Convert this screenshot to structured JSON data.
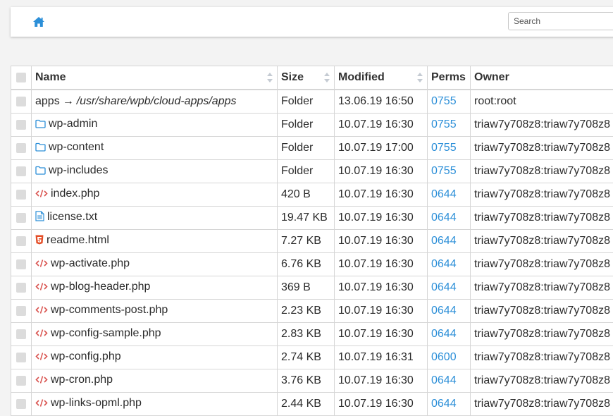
{
  "header": {
    "home_icon": "home-icon",
    "search_placeholder": "Search"
  },
  "colors": {
    "accent": "#2c8fd8",
    "code_icon": "#d9534f",
    "html_icon": "#e44d26"
  },
  "table": {
    "columns": {
      "name": "Name",
      "size": "Size",
      "modified": "Modified",
      "perms": "Perms",
      "owner": "Owner"
    },
    "rows": [
      {
        "type": "symlink",
        "name": "apps",
        "arrow": "→",
        "target": "/usr/share/wpb/cloud-apps/apps",
        "size": "Folder",
        "modified": "13.06.19 16:50",
        "perms": "0755",
        "owner": "root:root"
      },
      {
        "type": "folder",
        "icon": "folder-icon",
        "name": "wp-admin",
        "size": "Folder",
        "modified": "10.07.19 16:30",
        "perms": "0755",
        "owner": "triaw7y708z8:triaw7y708z8"
      },
      {
        "type": "folder",
        "icon": "folder-icon",
        "name": "wp-content",
        "size": "Folder",
        "modified": "10.07.19 17:00",
        "perms": "0755",
        "owner": "triaw7y708z8:triaw7y708z8"
      },
      {
        "type": "folder",
        "icon": "folder-icon",
        "name": "wp-includes",
        "size": "Folder",
        "modified": "10.07.19 16:30",
        "perms": "0755",
        "owner": "triaw7y708z8:triaw7y708z8"
      },
      {
        "type": "code",
        "icon": "code-icon",
        "name": "index.php",
        "size": "420 B",
        "modified": "10.07.19 16:30",
        "perms": "0644",
        "owner": "triaw7y708z8:triaw7y708z8"
      },
      {
        "type": "text",
        "icon": "text-file-icon",
        "name": "license.txt",
        "size": "19.47 KB",
        "modified": "10.07.19 16:30",
        "perms": "0644",
        "owner": "triaw7y708z8:triaw7y708z8"
      },
      {
        "type": "html",
        "icon": "html5-icon",
        "name": "readme.html",
        "size": "7.27 KB",
        "modified": "10.07.19 16:30",
        "perms": "0644",
        "owner": "triaw7y708z8:triaw7y708z8"
      },
      {
        "type": "code",
        "icon": "code-icon",
        "name": "wp-activate.php",
        "size": "6.76 KB",
        "modified": "10.07.19 16:30",
        "perms": "0644",
        "owner": "triaw7y708z8:triaw7y708z8"
      },
      {
        "type": "code",
        "icon": "code-icon",
        "name": "wp-blog-header.php",
        "size": "369 B",
        "modified": "10.07.19 16:30",
        "perms": "0644",
        "owner": "triaw7y708z8:triaw7y708z8"
      },
      {
        "type": "code",
        "icon": "code-icon",
        "name": "wp-comments-post.php",
        "size": "2.23 KB",
        "modified": "10.07.19 16:30",
        "perms": "0644",
        "owner": "triaw7y708z8:triaw7y708z8"
      },
      {
        "type": "code",
        "icon": "code-icon",
        "name": "wp-config-sample.php",
        "size": "2.83 KB",
        "modified": "10.07.19 16:30",
        "perms": "0644",
        "owner": "triaw7y708z8:triaw7y708z8"
      },
      {
        "type": "code",
        "icon": "code-icon",
        "name": "wp-config.php",
        "size": "2.74 KB",
        "modified": "10.07.19 16:31",
        "perms": "0600",
        "owner": "triaw7y708z8:triaw7y708z8"
      },
      {
        "type": "code",
        "icon": "code-icon",
        "name": "wp-cron.php",
        "size": "3.76 KB",
        "modified": "10.07.19 16:30",
        "perms": "0644",
        "owner": "triaw7y708z8:triaw7y708z8"
      },
      {
        "type": "code",
        "icon": "code-icon",
        "name": "wp-links-opml.php",
        "size": "2.44 KB",
        "modified": "10.07.19 16:30",
        "perms": "0644",
        "owner": "triaw7y708z8:triaw7y708z8"
      }
    ]
  }
}
